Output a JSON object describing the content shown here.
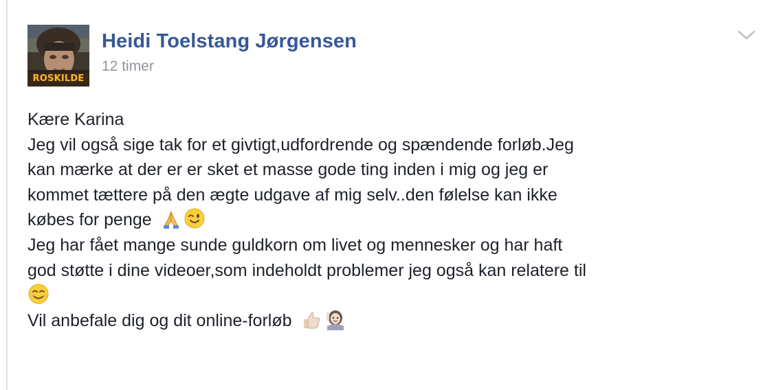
{
  "post": {
    "author": {
      "name": "Heidi Toelstang Jørgensen",
      "avatar_caption": "ROSKILDE"
    },
    "timestamp": "12 timer",
    "menu_icon": "chevron-down-icon",
    "lines": [
      "Kære Karina",
      "Jeg vil også sige tak for et givtigt,udfordrende og spændende forløb.Jeg",
      "kan mærke at der er er sket et masse gode ting inden i mig og jeg er",
      "kommet tættere på den ægte udgave af mig selv..den følelse kan ikke",
      "købes for penge",
      "Jeg har fået mange sunde guldkorn om livet og mennesker og har haft",
      "god støtte i dine videoer,som indeholdt problemer jeg også kan relatere til",
      "Vil anbefale dig og dit online-forløb"
    ],
    "emojis": [
      "folded-hands-emoji",
      "winking-face-emoji",
      "smiling-face-emoji",
      "thumbs-up-emoji",
      "woman-raising-hand-emoji"
    ]
  },
  "colors": {
    "name": "#365899",
    "timestamp": "#90949c",
    "text": "#1d2129",
    "chevron": "#bec2c9",
    "divider": "#dddfe2"
  }
}
